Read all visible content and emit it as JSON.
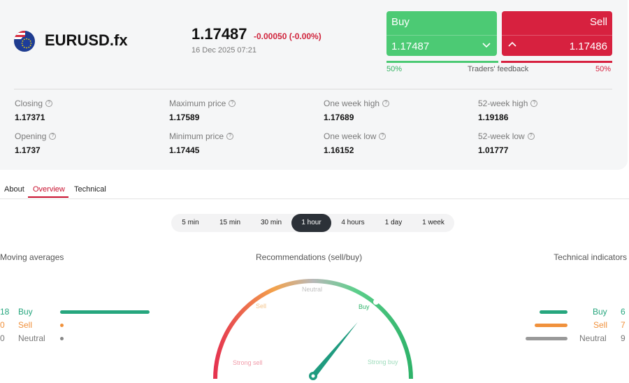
{
  "instrument": {
    "symbol": "EURUSD.fx",
    "flag_icon": "eu-us-flag-icon",
    "price": "1.17487",
    "change": "-0.00050 (-0.00%)",
    "datetime": "16 Dec 2025 07:21"
  },
  "trade": {
    "buy_label": "Buy",
    "buy_price": "1.17487",
    "sell_label": "Sell",
    "sell_price": "1.17486",
    "buy_percent_text": "50%",
    "sell_percent_text": "50%",
    "buy_share": 0.5,
    "feedback_label": "Traders' feedback",
    "colors": {
      "buy": "#4cca74",
      "sell": "#d7213f"
    }
  },
  "stats": [
    {
      "name": "Closing",
      "value": "1.17371"
    },
    {
      "name": "Maximum price",
      "value": "1.17589"
    },
    {
      "name": "One week high",
      "value": "1.17689"
    },
    {
      "name": "52-week high",
      "value": "1.19186"
    },
    {
      "name": "Opening",
      "value": "1.1737"
    },
    {
      "name": "Minimum price",
      "value": "1.17445"
    },
    {
      "name": "One week low",
      "value": "1.16152"
    },
    {
      "name": "52-week low",
      "value": "1.01777"
    }
  ],
  "tabs": [
    {
      "label": "About",
      "active": false
    },
    {
      "label": "Overview",
      "active": true
    },
    {
      "label": "Technical",
      "active": false
    }
  ],
  "timeframes": [
    {
      "label": "5 min",
      "active": false
    },
    {
      "label": "15 min",
      "active": false
    },
    {
      "label": "30 min",
      "active": false
    },
    {
      "label": "1 hour",
      "active": true
    },
    {
      "label": "4 hours",
      "active": false
    },
    {
      "label": "1 day",
      "active": false
    },
    {
      "label": "1 week",
      "active": false
    }
  ],
  "moving_averages": {
    "title": "Moving averages",
    "rows": [
      {
        "count": "18",
        "label": "Buy",
        "color": "#26a67e",
        "share": 1.0
      },
      {
        "count": "0",
        "label": "Sell",
        "color": "#f0913c",
        "share": 0.0
      },
      {
        "count": "0",
        "label": "Neutral",
        "color": "#888888",
        "share": 0.0
      }
    ]
  },
  "recommendations": {
    "title": "Recommendations (sell/buy)",
    "zones": [
      "Strong sell",
      "Sell",
      "Neutral",
      "Buy",
      "Strong buy"
    ],
    "needle_zone": "Buy",
    "needle_level": 0.72
  },
  "technical_indicators": {
    "title": "Technical indicators",
    "rows": [
      {
        "count": "6",
        "label": "Buy",
        "color": "#26a67e",
        "share": 0.67
      },
      {
        "count": "7",
        "label": "Sell",
        "color": "#f0913c",
        "share": 0.78
      },
      {
        "count": "9",
        "label": "Neutral",
        "color": "#999999",
        "share": 1.0
      }
    ]
  }
}
